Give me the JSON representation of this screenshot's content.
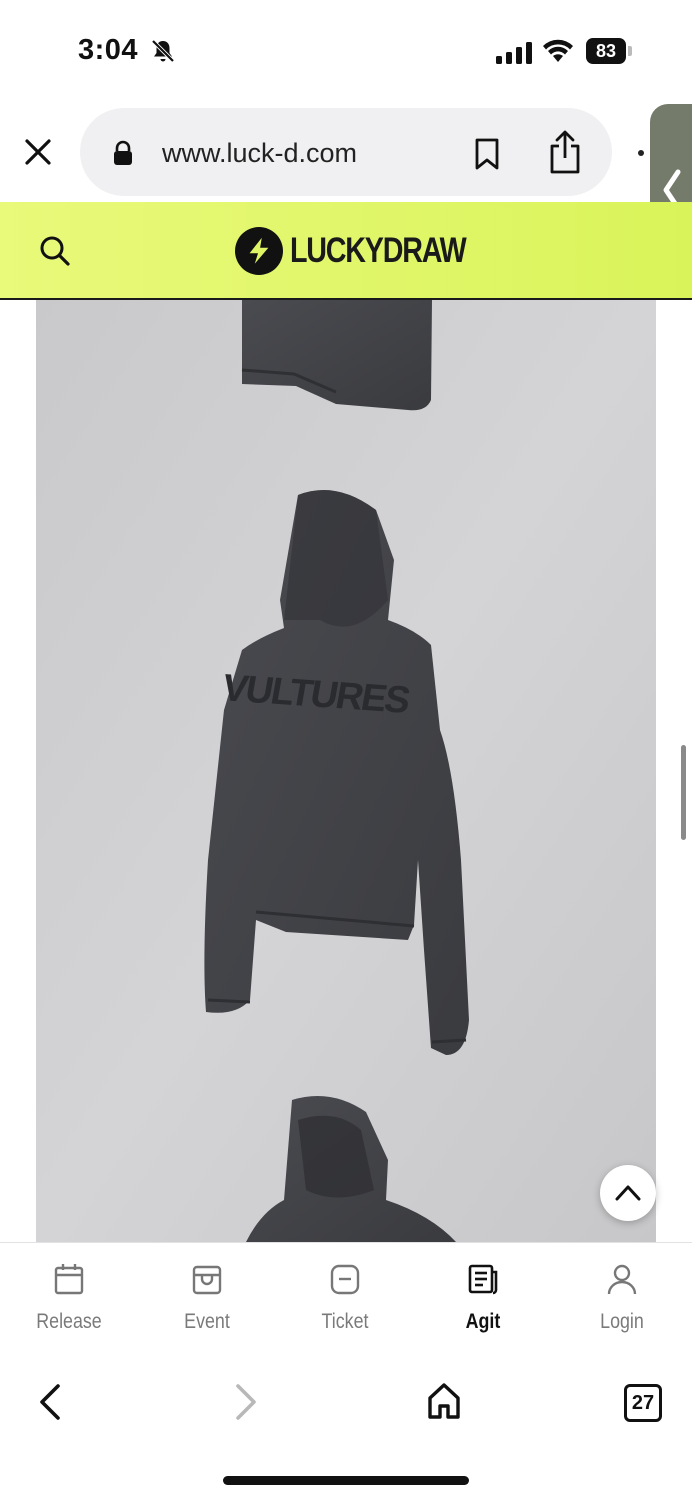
{
  "status_bar": {
    "time": "3:04",
    "battery_level": "83"
  },
  "browser": {
    "url": "www.luck-d.com",
    "tab_count": "27"
  },
  "site": {
    "logo_text": "LUCKYDRAW",
    "brand_color": "#dff565"
  },
  "product": {
    "print_text": "VULTURES"
  },
  "tab_bar": {
    "items": [
      {
        "label": "Release",
        "icon": "calendar-icon",
        "active": false
      },
      {
        "label": "Event",
        "icon": "store-icon",
        "active": false
      },
      {
        "label": "Ticket",
        "icon": "ticket-icon",
        "active": false
      },
      {
        "label": "Agit",
        "icon": "newspaper-icon",
        "active": true
      },
      {
        "label": "Login",
        "icon": "user-icon",
        "active": false
      }
    ]
  }
}
